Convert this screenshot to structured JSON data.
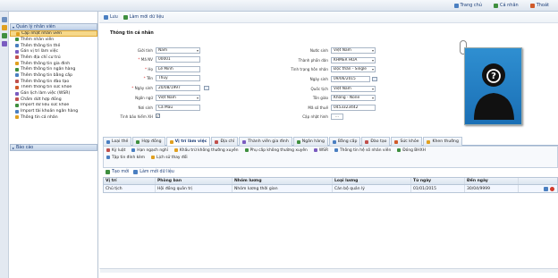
{
  "topbar": {
    "links": [
      {
        "label": "Trang chủ",
        "icon": "home-icon",
        "color": "#4a7fc1"
      },
      {
        "label": "Cá nhân",
        "icon": "user-icon",
        "color": "#3f8f3f"
      },
      {
        "label": "Thoát",
        "icon": "exit-icon",
        "color": "#d05a2a"
      }
    ]
  },
  "sidebar": {
    "group_label": "Quản lý nhân viên",
    "items": [
      {
        "label": "Cập nhật nhân viên",
        "color": "#e0a020"
      },
      {
        "label": "Thêm nhân viên",
        "color": "#3f8f3f"
      },
      {
        "label": "Thêm thông tin thẻ",
        "color": "#4a7fc1"
      },
      {
        "label": "Gán vị trí làm việc",
        "color": "#7a5cc0"
      },
      {
        "label": "Thêm địa chỉ cư trú",
        "color": "#c0504d"
      },
      {
        "label": "Thêm thông tin gia đình",
        "color": "#e0a020"
      },
      {
        "label": "Thêm thông tin ngân hàng",
        "color": "#3f8f3f"
      },
      {
        "label": "Thêm thông tin bằng cấp",
        "color": "#4a7fc1"
      },
      {
        "label": "Thêm thông tin đào tạo",
        "color": "#c0504d"
      },
      {
        "label": "Thêm thông tin sức khỏe",
        "color": "#d05a2a"
      },
      {
        "label": "Gán lịch làm việc (WSR)",
        "color": "#7a5cc0"
      },
      {
        "label": "Chấm dứt hợp đồng",
        "color": "#c0504d"
      },
      {
        "label": "Import dữ liệu sức khỏe",
        "color": "#3f8f3f"
      },
      {
        "label": "Import tài khoản ngân hàng",
        "color": "#4a7fc1"
      },
      {
        "label": "Thông tin cá nhân",
        "color": "#e0a020"
      }
    ],
    "footer_label": "Báo cáo"
  },
  "toolbar": {
    "save_label": "Lưu",
    "refresh_label": "Làm mới dữ liệu"
  },
  "form": {
    "section_title": "Thông tin cá nhân",
    "gender_label": "Giới tính",
    "gender_value": "Nam",
    "code_label": "Mã NV",
    "code_value": "00001",
    "lastname_label": "Họ",
    "lastname_value": "Lê Minh",
    "firstname_label": "Tên",
    "firstname_value": "Thủy",
    "dob_label": "Ngày sinh",
    "dob_value": "20/08/1997",
    "language_label": "Ngôn ngữ",
    "language_value": "Việt Nam",
    "birthplace_label": "Nơi sinh",
    "birthplace_value": "Cà Mau",
    "insurance_label": "Tính bảo hiểm XH",
    "country_label": "Nước sinh",
    "country_value": "Việt Nam",
    "ethnic_label": "Thành phần dân",
    "ethnic_value": "KHMER HOA",
    "marital_label": "Tình trạng hôn nhân",
    "marital_value": "Độc thân - Single",
    "effective_label": "Ngày sinh",
    "effective_value": "09/06/2015",
    "nationality_label": "Quốc tịch",
    "nationality_value": "Việt Nam",
    "religion_label": "Tôn giáo",
    "religion_value": "Không - None",
    "tax_label": "Mã số thuế",
    "tax_value": "0453323442",
    "update_label": "Cập nhật hình",
    "update_button": "..."
  },
  "tabs": [
    {
      "label": "Loại thẻ",
      "color": "#4a7fc1"
    },
    {
      "label": "Hợp đồng",
      "color": "#3f8f3f"
    },
    {
      "label": "Vị trí làm việc",
      "color": "#e0a020"
    },
    {
      "label": "Địa chỉ",
      "color": "#c0504d"
    },
    {
      "label": "Thành viên gia đình",
      "color": "#7a5cc0"
    },
    {
      "label": "Ngân hàng",
      "color": "#3f8f3f"
    },
    {
      "label": "Bằng cấp",
      "color": "#4a7fc1"
    },
    {
      "label": "Đào tạo",
      "color": "#c0504d"
    },
    {
      "label": "Sức khỏe",
      "color": "#d05a2a"
    },
    {
      "label": "Khen thưởng",
      "color": "#e0a020"
    }
  ],
  "subtabs_row1": [
    {
      "label": "Kỷ luật",
      "color": "#c0504d"
    },
    {
      "label": "Hạn ngạch nghỉ",
      "color": "#4a7fc1"
    },
    {
      "label": "Khấu trừ không thường xuyên",
      "color": "#e0a020"
    },
    {
      "label": "Phụ cấp không thường xuyên",
      "color": "#3f8f3f"
    },
    {
      "label": "WSR",
      "color": "#7a5cc0"
    },
    {
      "label": "Thông tin hệ số nhân viên",
      "color": "#4a7fc1"
    },
    {
      "label": "Đóng BHXH",
      "color": "#3f8f3f"
    }
  ],
  "subtabs_row2": [
    {
      "label": "Tập tin đính kèm",
      "color": "#4a7fc1"
    },
    {
      "label": "Lịch sử thay đổi",
      "color": "#e0a020"
    }
  ],
  "actions": {
    "new_label": "Tạo mới",
    "refresh_label": "Làm mới dữ liệu"
  },
  "table": {
    "headers": [
      "Vị trí",
      "Phòng ban",
      "Nhóm lương",
      "Loại lương",
      "Từ ngày",
      "Đến ngày"
    ],
    "rows": [
      [
        "Chủ tịch",
        "Hội đồng quản trị",
        "Nhóm lương thời gian",
        "Cán bộ quản lý",
        "01/01/2015",
        "30/04/9999"
      ]
    ]
  }
}
